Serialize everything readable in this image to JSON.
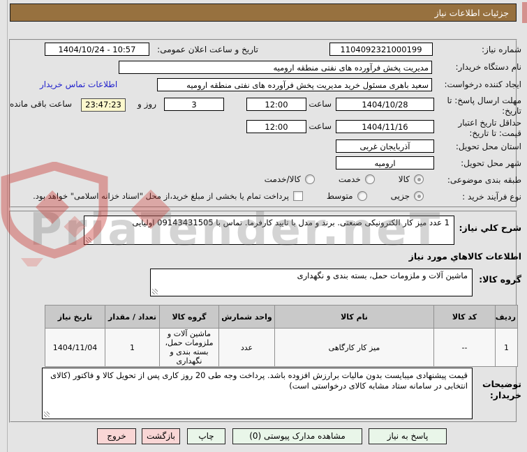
{
  "header": {
    "title": "جزئیات اطلاعات نیاز"
  },
  "form": {
    "need_number": {
      "label": "شماره نیاز:",
      "value": "1104092321000199"
    },
    "announce": {
      "label": "تاریخ و ساعت اعلان عمومی:",
      "value": "1404/10/24 - 10:57"
    },
    "buyer_org": {
      "label": "نام دستگاه خریدار:",
      "value": "مدیریت پخش فرآورده های نفتی منطقه ارومیه"
    },
    "creator": {
      "label": "ایجاد کننده درخواست:",
      "value": "سعید باهری مسئول خرید مدیریت پخش فرآورده های نفتی منطقه ارومیه",
      "contact_link": "اطلاعات تماس خریدار"
    },
    "deadline": {
      "label": "مهلت ارسال پاسخ: تا تاریخ:",
      "date": "1404/10/28",
      "hour_label": "ساعت",
      "time": "12:00",
      "days": "3",
      "days_label": "روز و",
      "countdown": "23:47:23",
      "remaining_label": "ساعت باقی مانده"
    },
    "validity": {
      "label": "حداقل تاریخ اعتبار قیمت: تا تاریخ:",
      "date": "1404/11/16",
      "hour_label": "ساعت",
      "time": "12:00"
    },
    "province": {
      "label": "استان محل تحویل:",
      "value": "آذربایجان غربی"
    },
    "city": {
      "label": "شهر محل تحویل:",
      "value": "ارومیه"
    },
    "subject": {
      "label": "طبقه بندی موضوعی:",
      "opt1": "کالا",
      "opt2": "خدمت",
      "opt3": "کالا/خدمت"
    },
    "process": {
      "label": "نوع فرآیند خرید :",
      "opt1": "جزیی",
      "opt2": "متوسط",
      "note": "پرداخت تمام یا بخشی از مبلغ خرید،از محل \"اسناد خزانه اسلامی\" خواهد بود."
    }
  },
  "description": {
    "label": "شرح کلي نیاز:",
    "value": "1 عدد میز کار الکترونیکی صنعتی. برند و مدل با تایید کارفرما. تماس با 09143431505 اولیایی"
  },
  "goods": {
    "title": "اطلاعات کالاهاي مورد نیاز",
    "group_label": "گروه کالا:",
    "group_value": "ماشین آلات و ملزومات حمل، بسته بندی و نگهداری"
  },
  "table": {
    "headers": [
      "ردیف",
      "کد کالا",
      "نام کالا",
      "واحد شمارش",
      "گروه کالا",
      "تعداد / مقدار",
      "تاریخ نیاز"
    ],
    "row": {
      "index": "1",
      "code": "--",
      "name": "میز کار کارگاهی",
      "unit": "عدد",
      "group": "ماشین آلات و ملزومات حمل، بسته بندی و نگهداری",
      "qty": "1",
      "need_date": "1404/11/04"
    }
  },
  "notes": {
    "label": "توضیحات خریدار:",
    "value": "قیمت پیشنهادی میبایست بدون مالیات برارزش افزوده باشد. پرداخت وجه طی 20 روز کاری پس از تحویل کالا و فاکتور (کالای انتخابی در سامانه ستاد مشابه کالای درخواستی است)"
  },
  "buttons": {
    "respond": "پاسخ به نیاز",
    "attachments": "مشاهده مدارک پیوستی (0)",
    "print": "چاپ",
    "back": "بازگشت",
    "exit": "خروج"
  },
  "watermark": {
    "text": "PriaTender.neT"
  },
  "colors": {
    "header_bg": "#97713f",
    "countdown_bg": "#fcf8cd",
    "button_green": "#e9f6e9",
    "button_pink": "#f9d6d5",
    "link_blue": "#2222cc",
    "table_header_bg": "#c9c9c9"
  }
}
